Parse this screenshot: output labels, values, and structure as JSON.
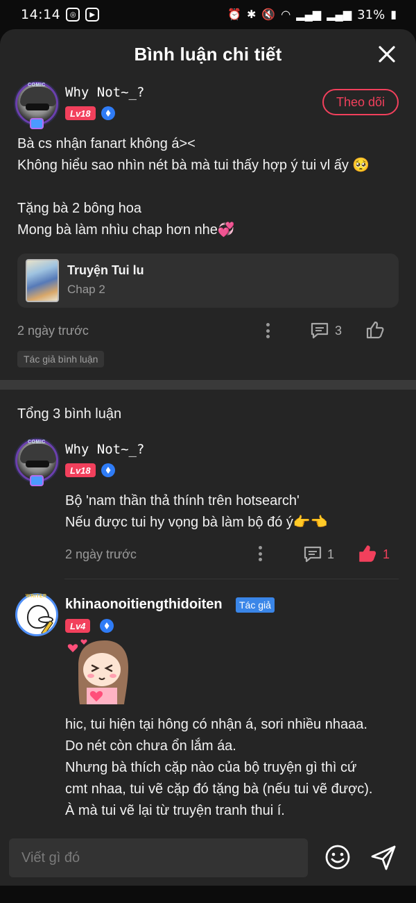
{
  "status_bar": {
    "time": "14:14",
    "battery": "31%"
  },
  "header": {
    "title": "Bình luận chi tiết"
  },
  "main_comment": {
    "username": "Why Not~_?",
    "avatar_label": "COMIC",
    "level": "Lv18",
    "follow_label": "Theo dõi",
    "text": "Bà cs nhận fanart không á><\nKhông hiểu sao nhìn nét bà mà tui thấy hợp ý tui vl ấy 🥺\n\nTặng bà 2 bông hoa\nMong bà làm nhìu chap hơn nhe💞",
    "story": {
      "title": "Truyện Tui lu",
      "chapter": "Chap 2"
    },
    "time": "2 ngày trước",
    "reply_count": "3",
    "tag": "Tác giả bình luận"
  },
  "replies": {
    "total_label": "Tổng 3 bình luận",
    "items": [
      {
        "username": "Why Not~_?",
        "avatar_label": "COMIC",
        "level": "Lv18",
        "text": "Bộ 'nam thần thả thính trên hotsearch'\nNếu được tui hy vọng bà làm bộ đó ý👉👈",
        "time": "2 ngày trước",
        "reply_count": "1",
        "like_count": "1"
      },
      {
        "username": "khinaonoitiengthidoiten",
        "avatar_label": "WRITER",
        "author_tag": "Tác giả",
        "level": "Lv4",
        "text": "hic, tui hiện tại hông có nhận á, sori nhiều nhaaa.\nDo nét còn chưa ổn lắm áa.\nNhưng bà thích cặp nào của bộ truyện gì thì cứ\ncmt nhaa, tui vẽ cặp đó tặng bà (nếu tui vẽ được).\nÀ mà tui vẽ lại từ truyện tranh thui í."
      }
    ]
  },
  "input": {
    "placeholder": "Viết gì đó"
  },
  "colors": {
    "accent": "#f2405c",
    "sheet_bg": "#252525",
    "author_tag": "#3a86e8"
  },
  "icons": [
    "close-icon",
    "comment-icon",
    "like-icon",
    "more-icon",
    "emoji-icon",
    "send-icon",
    "verified-icon"
  ]
}
